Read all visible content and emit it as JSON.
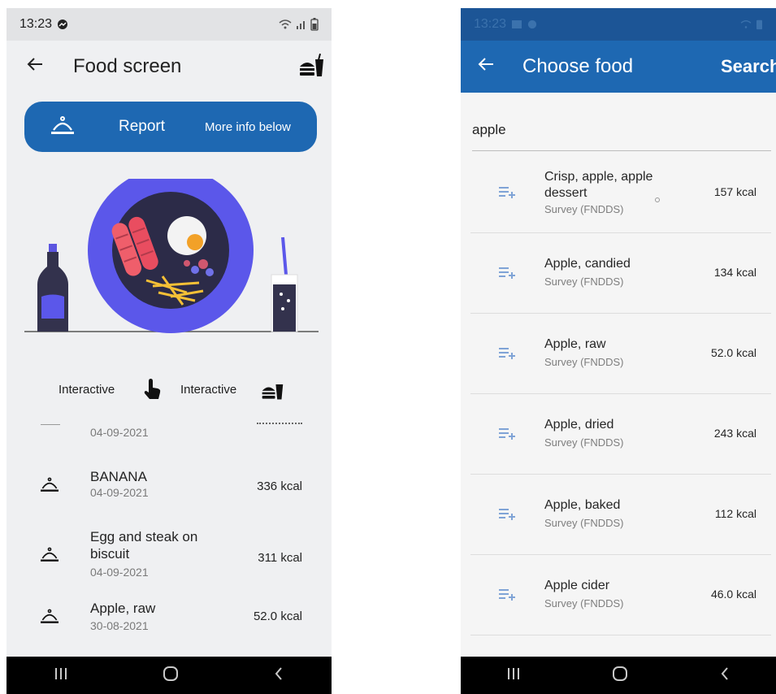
{
  "left_phone": {
    "status": {
      "time": "13:23"
    },
    "appbar": {
      "title": "Food screen",
      "back_icon": "arrow-left-icon",
      "action_icon": "fast-food-icon"
    },
    "report_button": {
      "label": "Report",
      "more": "More info below",
      "icon": "cloche-icon"
    },
    "interactive_row": {
      "label_1": "Interactive",
      "label_2": "Interactive"
    },
    "partial_item": {
      "date": "04-09-2021"
    },
    "items": [
      {
        "name": "BANANA",
        "date": "04-09-2021",
        "kcal": "336 kcal"
      },
      {
        "name": "Egg and steak on biscuit",
        "date": "04-09-2021",
        "kcal": "311 kcal"
      },
      {
        "name": "Apple, raw",
        "date": "30-08-2021",
        "kcal": "52.0 kcal"
      }
    ]
  },
  "right_phone": {
    "status": {
      "time": "13:23"
    },
    "appbar": {
      "title": "Choose food",
      "action": "Search",
      "back_icon": "arrow-left-icon"
    },
    "search": {
      "value": "apple"
    },
    "results": [
      {
        "name": "Crisp, apple, apple dessert",
        "source": "Survey (FNDDS)",
        "kcal": "157 kcal"
      },
      {
        "name": "Apple, candied",
        "source": "Survey (FNDDS)",
        "kcal": "134 kcal"
      },
      {
        "name": "Apple, raw",
        "source": "Survey (FNDDS)",
        "kcal": "52.0 kcal"
      },
      {
        "name": "Apple, dried",
        "source": "Survey (FNDDS)",
        "kcal": "243 kcal"
      },
      {
        "name": "Apple, baked",
        "source": "Survey (FNDDS)",
        "kcal": "112 kcal"
      },
      {
        "name": "Apple cider",
        "source": "Survey (FNDDS)",
        "kcal": "46.0 kcal"
      }
    ]
  },
  "colors": {
    "primary": "#1e68b2",
    "plate_ring": "#5b57ea",
    "plate_inner": "#2c2b48",
    "bottle": "#33324d"
  }
}
